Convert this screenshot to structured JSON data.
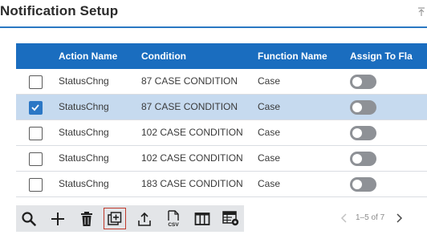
{
  "page": {
    "title": "Notification Setup"
  },
  "grid": {
    "columns": [
      "Action Name",
      "Condition",
      "Function Name",
      "Assign To Fla"
    ],
    "rows": [
      {
        "selected": false,
        "action_name": "StatusChng",
        "condition": "87 CASE CONDITION",
        "function_name": "Case",
        "assign_to_flag": false
      },
      {
        "selected": true,
        "action_name": "StatusChng",
        "condition": "87 CASE CONDITION",
        "function_name": "Case",
        "assign_to_flag": false
      },
      {
        "selected": false,
        "action_name": "StatusChng",
        "condition": "102 CASE CONDITION",
        "function_name": "Case",
        "assign_to_flag": false
      },
      {
        "selected": false,
        "action_name": "StatusChng",
        "condition": "102 CASE CONDITION",
        "function_name": "Case",
        "assign_to_flag": false
      },
      {
        "selected": false,
        "action_name": "StatusChng",
        "condition": "183 CASE CONDITION",
        "function_name": "Case",
        "assign_to_flag": false
      }
    ]
  },
  "toolbar": {
    "icons": [
      "search-icon",
      "add-icon",
      "delete-icon",
      "copy-icon",
      "upload-icon",
      "csv-export-icon",
      "columns-icon",
      "grid-settings-icon"
    ],
    "active_icon": "copy-icon",
    "csv_label": "CSV"
  },
  "pager": {
    "text": "1–5 of 7"
  },
  "colors": {
    "header_bg": "#1a6dbf",
    "selected_row": "#c6daef",
    "title_rule": "#2a78c2",
    "checkbox_checked": "#2b77c5",
    "toggle_off": "#8e9196",
    "toolbar_bg": "#e3e5e8",
    "active_outline": "#c0392b"
  }
}
